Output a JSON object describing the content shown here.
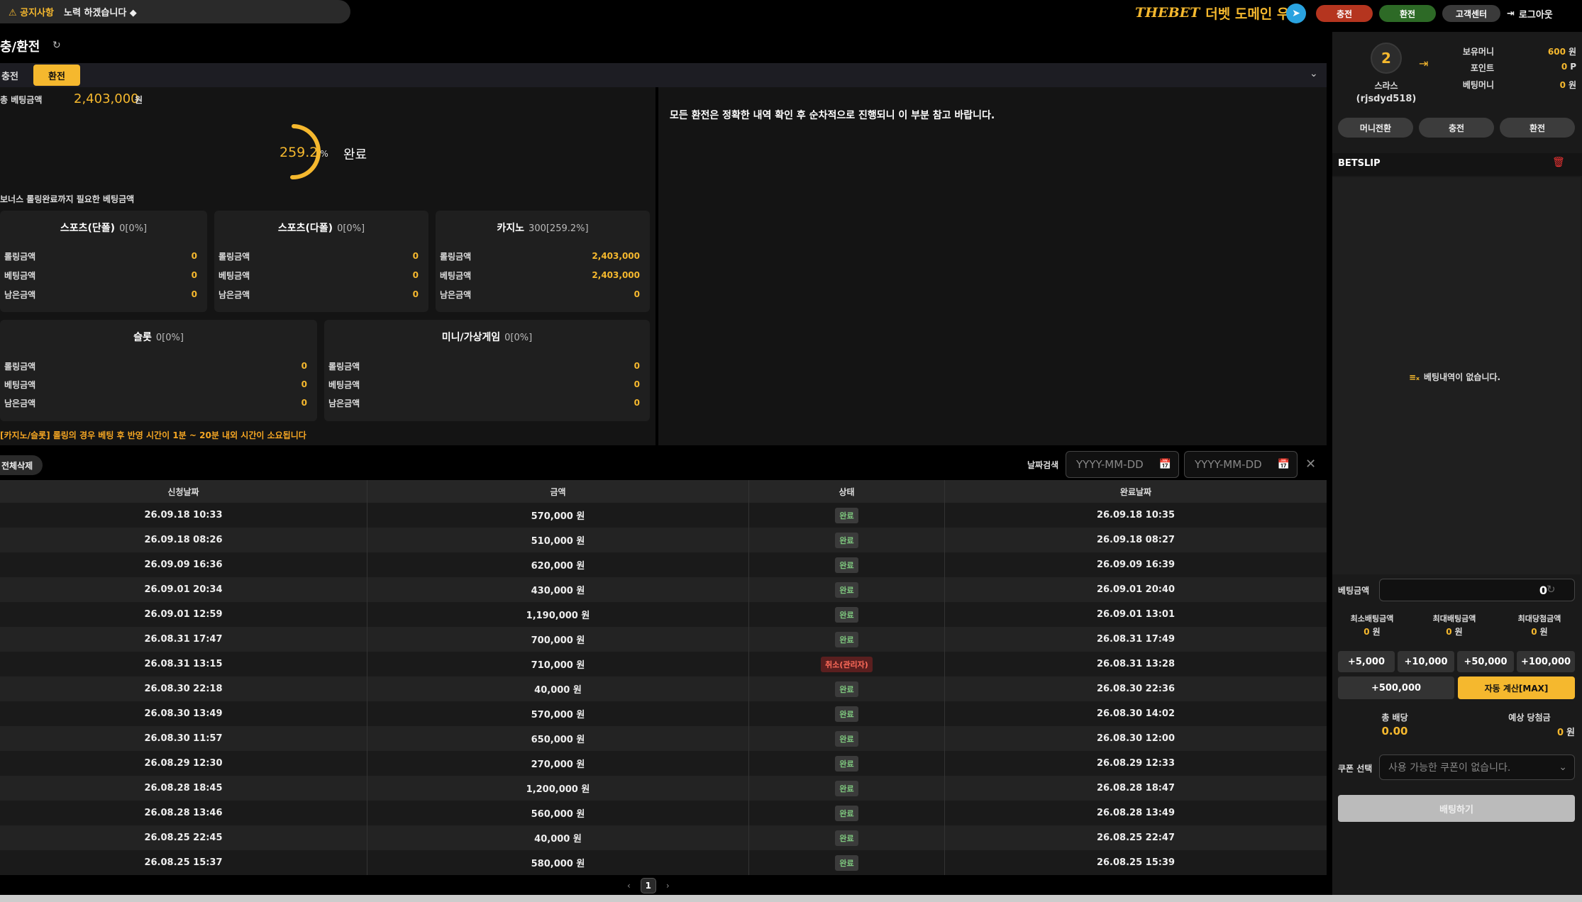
{
  "notice": {
    "tag": "⚠ 공지사항",
    "text": "노력 하겠습니다 ◆"
  },
  "header": {
    "brand": "THEBET",
    "slogan": "더벳 도메인 우회",
    "deposit": "충전",
    "withdraw": "환전",
    "cs": "고객센터",
    "logout": "로그아웃"
  },
  "page": {
    "title": "충/환전",
    "tabs": [
      "충전",
      "환전"
    ],
    "active_tab": "환전"
  },
  "rolling": {
    "total_label": "총 베팅금액",
    "total_value": "2,403,000",
    "total_unit": "원",
    "percent": "259.2",
    "percent_unit": "%",
    "status": "완료",
    "need_label": "보너스 롤링완료까지 필요한 베팅금액",
    "row_labels": [
      "롤링금액",
      "베팅금액",
      "남은금액"
    ],
    "cards": [
      {
        "title": "스포츠(단폴)",
        "rate": "0[0%]",
        "values": [
          "0",
          "0",
          "0"
        ]
      },
      {
        "title": "스포츠(다폴)",
        "rate": "0[0%]",
        "values": [
          "0",
          "0",
          "0"
        ]
      },
      {
        "title": "카지노",
        "rate": "300[259.2%]",
        "values": [
          "2,403,000",
          "2,403,000",
          "0"
        ]
      },
      {
        "title": "슬롯",
        "rate": "0[0%]",
        "values": [
          "0",
          "0",
          "0"
        ]
      },
      {
        "title": "미니/가상게임",
        "rate": "0[0%]",
        "values": [
          "0",
          "0",
          "0"
        ]
      }
    ],
    "note": "[카지노/슬롯] 롤링의 경우 베팅 후 반영 시간이 1분 ~ 20분 내외 시간이 소요됩니다"
  },
  "withdraw_message": "모든 환전은 정확한 내역 확인 후 순차적으로 진행되니 이 부분 참고 바랍니다.",
  "filter": {
    "delete_all": "전체삭제",
    "date_label": "날짜검색",
    "date_placeholder": "YYYY-MM-DD"
  },
  "table": {
    "headers": [
      "신청날짜",
      "금액",
      "상태",
      "완료날짜"
    ],
    "rows": [
      {
        "date": "26.09.18 10:33",
        "amount": "570,000 원",
        "status": "완료",
        "done": "26.09.18 10:35"
      },
      {
        "date": "26.09.18 08:26",
        "amount": "510,000 원",
        "status": "완료",
        "done": "26.09.18 08:27"
      },
      {
        "date": "26.09.09 16:36",
        "amount": "620,000 원",
        "status": "완료",
        "done": "26.09.09 16:39"
      },
      {
        "date": "26.09.01 20:34",
        "amount": "430,000 원",
        "status": "완료",
        "done": "26.09.01 20:40"
      },
      {
        "date": "26.09.01 12:59",
        "amount": "1,190,000 원",
        "status": "완료",
        "done": "26.09.01 13:01"
      },
      {
        "date": "26.08.31 17:47",
        "amount": "700,000 원",
        "status": "완료",
        "done": "26.08.31 17:49"
      },
      {
        "date": "26.08.31 13:15",
        "amount": "710,000 원",
        "status": "취소(관리자)",
        "done": "26.08.31 13:28"
      },
      {
        "date": "26.08.30 22:18",
        "amount": "40,000 원",
        "status": "완료",
        "done": "26.08.30 22:36"
      },
      {
        "date": "26.08.30 13:49",
        "amount": "570,000 원",
        "status": "완료",
        "done": "26.08.30 14:02"
      },
      {
        "date": "26.08.30 11:57",
        "amount": "650,000 원",
        "status": "완료",
        "done": "26.08.30 12:00"
      },
      {
        "date": "26.08.29 12:30",
        "amount": "270,000 원",
        "status": "완료",
        "done": "26.08.29 12:33"
      },
      {
        "date": "26.08.28 18:45",
        "amount": "1,200,000 원",
        "status": "완료",
        "done": "26.08.28 18:47"
      },
      {
        "date": "26.08.28 13:46",
        "amount": "560,000 원",
        "status": "완료",
        "done": "26.08.28 13:49"
      },
      {
        "date": "26.08.25 22:45",
        "amount": "40,000 원",
        "status": "완료",
        "done": "26.08.25 22:47"
      },
      {
        "date": "26.08.25 15:37",
        "amount": "580,000 원",
        "status": "완료",
        "done": "26.08.25 15:39"
      }
    ]
  },
  "pagination": {
    "prev": "‹",
    "current": "1",
    "next": "›"
  },
  "user": {
    "level": "2",
    "name": "스라스",
    "id": "(rjsdyd518)",
    "balance_label": "보유머니",
    "balance": "600",
    "balance_unit": "원",
    "point_label": "포인트",
    "point": "0",
    "point_unit": "P",
    "bet_money_label": "베팅머니",
    "bet_money": "0",
    "bet_money_unit": "원",
    "actions": [
      "머니전환",
      "충전",
      "환전"
    ]
  },
  "betslip": {
    "title": "BETSLIP",
    "empty": "베팅내역이 없습니다.",
    "amount_label": "베팅금액",
    "amount": "0",
    "min_label": "최소배팅금액",
    "min": "0",
    "max_label": "최대배팅금액",
    "max": "0",
    "maxwin_label": "최대당첨금액",
    "maxwin": "0",
    "unit": "원",
    "chips": [
      "+5,000",
      "+10,000",
      "+50,000",
      "+100,000",
      "+500,000"
    ],
    "auto_max": "자동 계산[MAX]",
    "odds_label": "총 배당",
    "odds": "0.00",
    "win_label": "예상 당첨금",
    "win": "0",
    "coupon_label": "쿠폰 선택",
    "coupon_placeholder": "사용 가능한 쿠폰이 없습니다.",
    "submit": "배팅하기"
  },
  "colors": {
    "accent": "#f5b82e",
    "deposit": "#b5351f",
    "withdraw": "#2d6a26",
    "cancel": "#ff6b5a",
    "ok": "#7fc97f"
  }
}
